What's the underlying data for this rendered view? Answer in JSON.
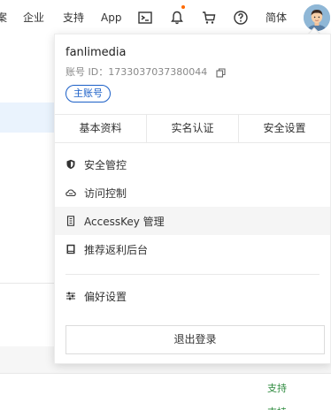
{
  "topnav": {
    "items": [
      {
        "label": "案"
      },
      {
        "label": "企业"
      },
      {
        "label": "支持"
      },
      {
        "label": "App"
      }
    ],
    "lang_label": "简体",
    "icons": [
      "terminal-icon",
      "bell-icon",
      "cart-icon",
      "help-icon"
    ]
  },
  "account": {
    "username": "fanlimedia",
    "id_label": "账号 ID：",
    "id_value": "1733037037380044",
    "badge": "主账号"
  },
  "tabs": [
    {
      "label": "基本资料"
    },
    {
      "label": "实名认证"
    },
    {
      "label": "安全设置"
    }
  ],
  "menu": [
    {
      "label": "安全管控",
      "icon": "shield-icon"
    },
    {
      "label": "访问控制",
      "icon": "cloud-icon"
    },
    {
      "label": "AccessKey 管理",
      "icon": "key-icon"
    },
    {
      "label": "推荐返利后台",
      "icon": "document-icon"
    },
    {
      "label": "偏好设置",
      "icon": "sliders-icon"
    }
  ],
  "logout_label": "退出登录",
  "background": {
    "links": [
      "支持",
      "支持"
    ]
  },
  "colors": {
    "accent": "#1b5fc7",
    "notification_dot": "#ff6a00",
    "link_green": "#2d8a3e"
  }
}
